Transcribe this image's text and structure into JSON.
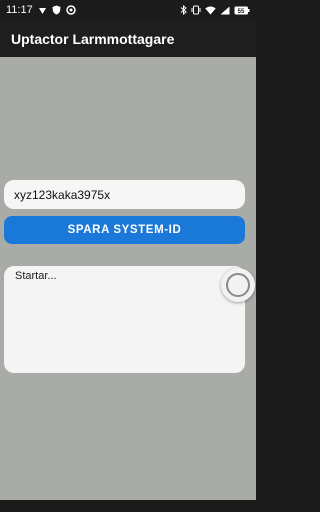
{
  "status_bar": {
    "time": "11:17",
    "battery_level": "55",
    "left_icons": [
      "signal-icon",
      "shield-icon",
      "sync-icon"
    ],
    "right_icons": [
      "bluetooth-icon",
      "vibrate-icon",
      "wifi-icon",
      "cell-signal-icon",
      "battery-icon"
    ]
  },
  "app_bar": {
    "title": "Uptactor Larmmottagare"
  },
  "system_id": {
    "value": "xyz123kaka3975x"
  },
  "save_button": {
    "label": "SPARA SYSTEM-ID"
  },
  "log": {
    "text": "Startar..."
  },
  "colors": {
    "content_bg": "#a9aba7",
    "button": "#1a78d8",
    "app_bar": "#1e1e1e"
  }
}
